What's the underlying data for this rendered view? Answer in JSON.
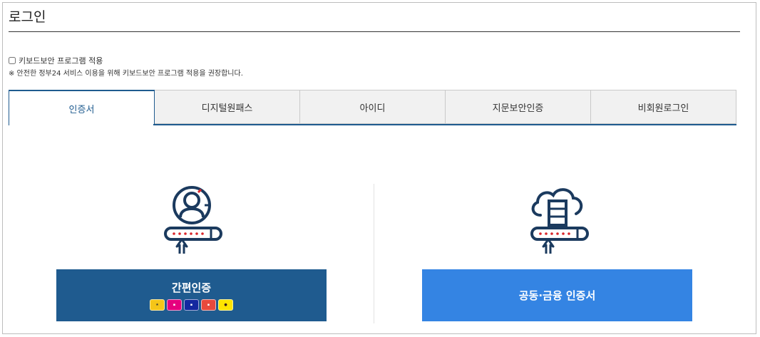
{
  "page": {
    "title": "로그인"
  },
  "keyboard_security": {
    "checkbox_label": "키보드보안 프로그램 적용",
    "checked": false,
    "note": "※ 안전한 정부24 서비스 이용을 위해 키보드보안 프로그램 적용을 권장합니다."
  },
  "tabs": [
    {
      "label": "인증서",
      "active": true
    },
    {
      "label": "디지털원패스",
      "active": false
    },
    {
      "label": "아이디",
      "active": false
    },
    {
      "label": "지문보안인증",
      "active": false
    },
    {
      "label": "비회원로그인",
      "active": false
    }
  ],
  "options": {
    "simple_auth": {
      "label": "간편인증",
      "icon": "user-password-icon",
      "providers": [
        {
          "name": "kb-icon",
          "color": "#f5c518"
        },
        {
          "name": "pass-icon",
          "color": "#e5007e"
        },
        {
          "name": "samsung-pass-icon",
          "color": "#1428a0"
        },
        {
          "name": "toss-icon",
          "color": "#e84a3c"
        },
        {
          "name": "kakao-icon",
          "color": "#fee500"
        }
      ]
    },
    "joint_cert": {
      "label": "공동·금융 인증서",
      "icon": "cloud-server-password-icon"
    }
  },
  "colors": {
    "navy": "#1f5b8f",
    "blue": "#3484e3",
    "icon_navy": "#1b3a5e",
    "icon_red": "#d9262b"
  }
}
